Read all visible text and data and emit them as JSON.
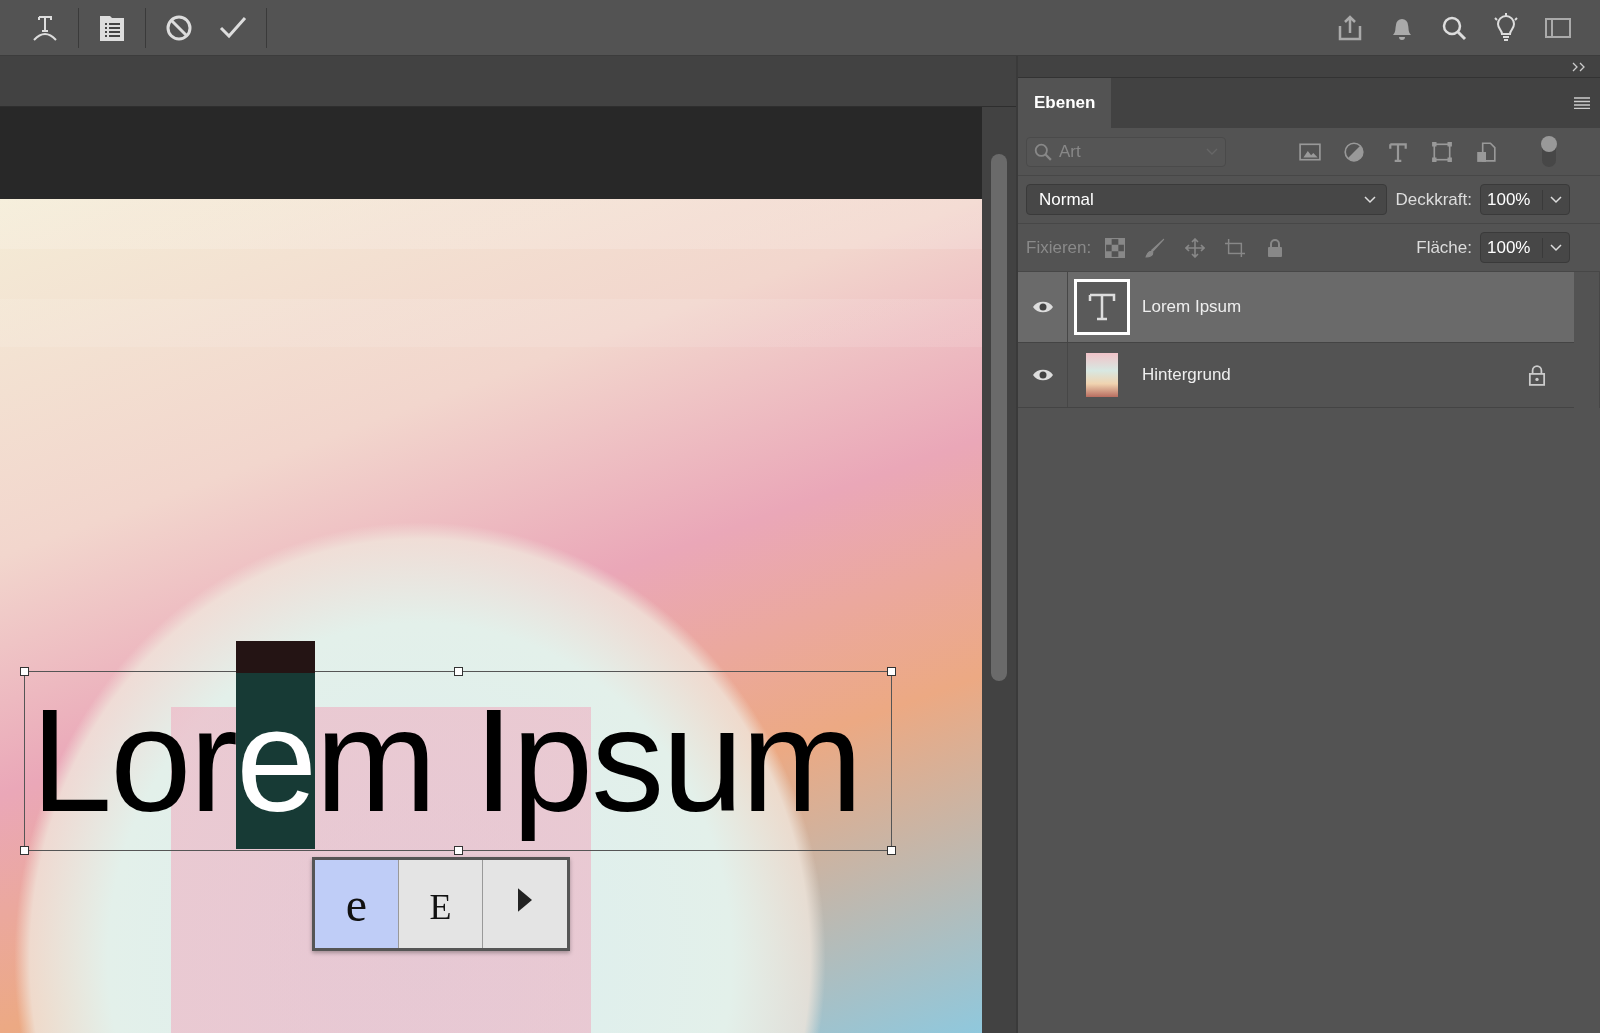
{
  "toolbar": {
    "left_tools": [
      {
        "kind": "warp-text"
      },
      {
        "kind": "panels"
      }
    ],
    "actions": [
      {
        "kind": "cancel"
      },
      {
        "kind": "commit"
      }
    ],
    "right_tools": [
      {
        "kind": "share"
      },
      {
        "kind": "notifications"
      },
      {
        "kind": "search"
      },
      {
        "kind": "tips"
      },
      {
        "kind": "workspace"
      }
    ]
  },
  "canvas": {
    "text_segments": [
      {
        "text": "Lor",
        "selected": false
      },
      {
        "text": "e",
        "selected": true
      },
      {
        "text": "m Ipsum",
        "selected": false
      }
    ],
    "glyph_popup": {
      "alternates": [
        {
          "glyph": "e",
          "kind": "lowercase",
          "selected": true
        },
        {
          "glyph": "E",
          "kind": "small-caps",
          "selected": false
        }
      ]
    }
  },
  "layers_panel": {
    "tabs": [
      {
        "label": "Ebenen",
        "selected": true
      }
    ],
    "filter": {
      "placeholder": "Art"
    },
    "blend_mode": "Normal",
    "opacity_label": "Deckkraft:",
    "opacity": "100%",
    "lock_label": "Fixieren:",
    "fill_label": "Fläche:",
    "fill": "100%",
    "layers": [
      {
        "name": "Lorem Ipsum",
        "kind": "text",
        "visible": true,
        "selected": true,
        "locked": false
      },
      {
        "name": "Hintergrund",
        "kind": "image",
        "visible": true,
        "selected": false,
        "locked": true
      }
    ]
  }
}
